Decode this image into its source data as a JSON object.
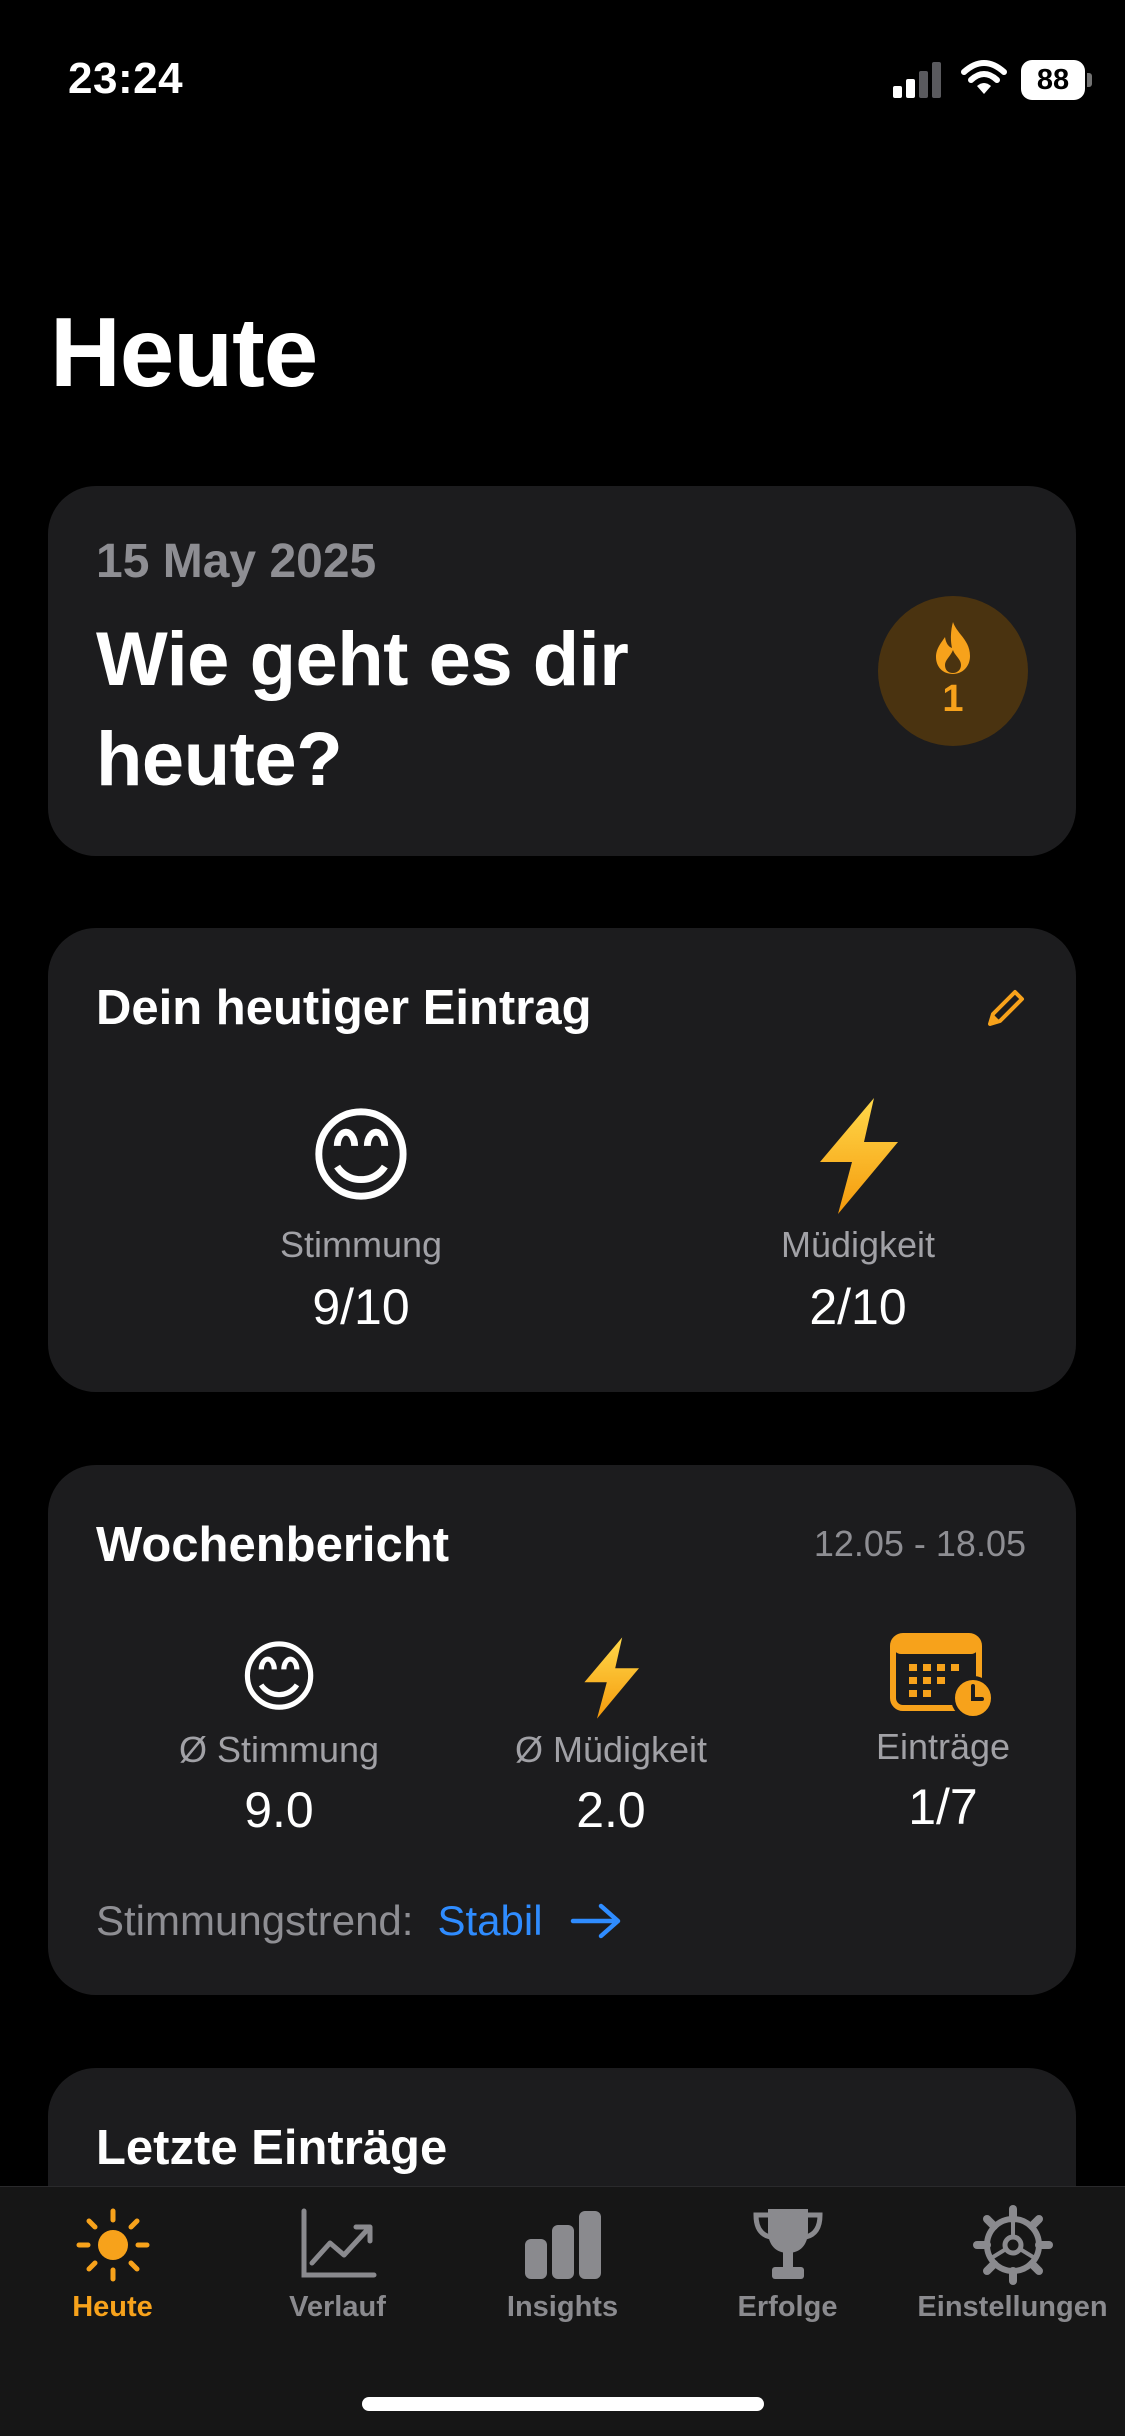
{
  "status_bar": {
    "time": "23:24",
    "battery": "88"
  },
  "page": {
    "title": "Heute"
  },
  "today_card": {
    "date": "15 May 2025",
    "question": "Wie geht es dir heute?",
    "streak_count": "1"
  },
  "entry_card": {
    "title": "Dein heutiger Eintrag",
    "mood": {
      "emoji": "😊",
      "label": "Stimmung",
      "value": "9/10"
    },
    "fatigue": {
      "icon": "lightning-bolt",
      "label": "Müdigkeit",
      "value": "2/10"
    }
  },
  "week_card": {
    "title": "Wochenbericht",
    "range": "12.05 - 18.05",
    "avg_mood": {
      "emoji": "😊",
      "label": "Ø Stimmung",
      "value": "9.0"
    },
    "avg_fatigue": {
      "icon": "lightning-bolt",
      "label": "Ø Müdigkeit",
      "value": "2.0"
    },
    "entries": {
      "icon": "calendar-clock",
      "label": "Einträge",
      "value": "1/7"
    },
    "trend_label": "Stimmungstrend:",
    "trend_value": "Stabil"
  },
  "recent_card": {
    "title": "Letzte Einträge"
  },
  "tab_bar": {
    "tabs": [
      {
        "label": "Heute",
        "icon": "sun",
        "active": true
      },
      {
        "label": "Verlauf",
        "icon": "line-chart",
        "active": false
      },
      {
        "label": "Insights",
        "icon": "bar-chart",
        "active": false
      },
      {
        "label": "Erfolge",
        "icon": "trophy",
        "active": false
      },
      {
        "label": "Einstellungen",
        "icon": "gear",
        "active": false
      }
    ]
  },
  "colors": {
    "accent": "#f7a21b",
    "link": "#2f8cff",
    "card_bg": "#1c1c1e",
    "secondary_text": "#8e8e93"
  }
}
